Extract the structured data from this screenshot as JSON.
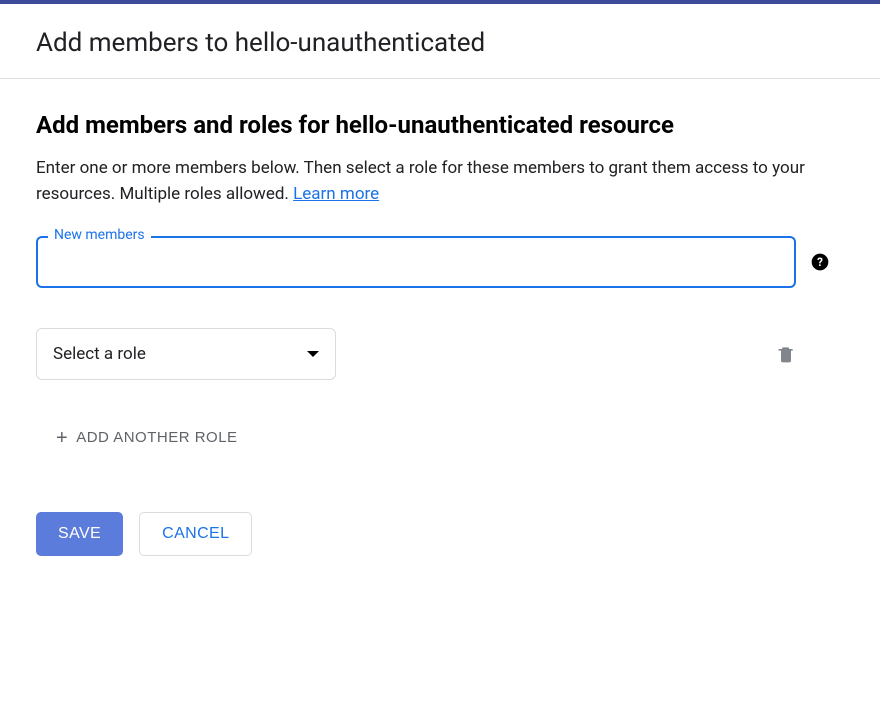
{
  "header": {
    "title": "Add members to hello-unauthenticated"
  },
  "main": {
    "section_title": "Add members and roles for hello-unauthenticated resource",
    "description_part1": "Enter one or more members below. Then select a role for these members to grant them access to your resources. Multiple roles allowed. ",
    "learn_more_label": "Learn more",
    "members_label": "New members",
    "members_value": "",
    "role_select_label": "Select a role",
    "add_role_label": "ADD ANOTHER ROLE"
  },
  "actions": {
    "save_label": "SAVE",
    "cancel_label": "CANCEL"
  }
}
